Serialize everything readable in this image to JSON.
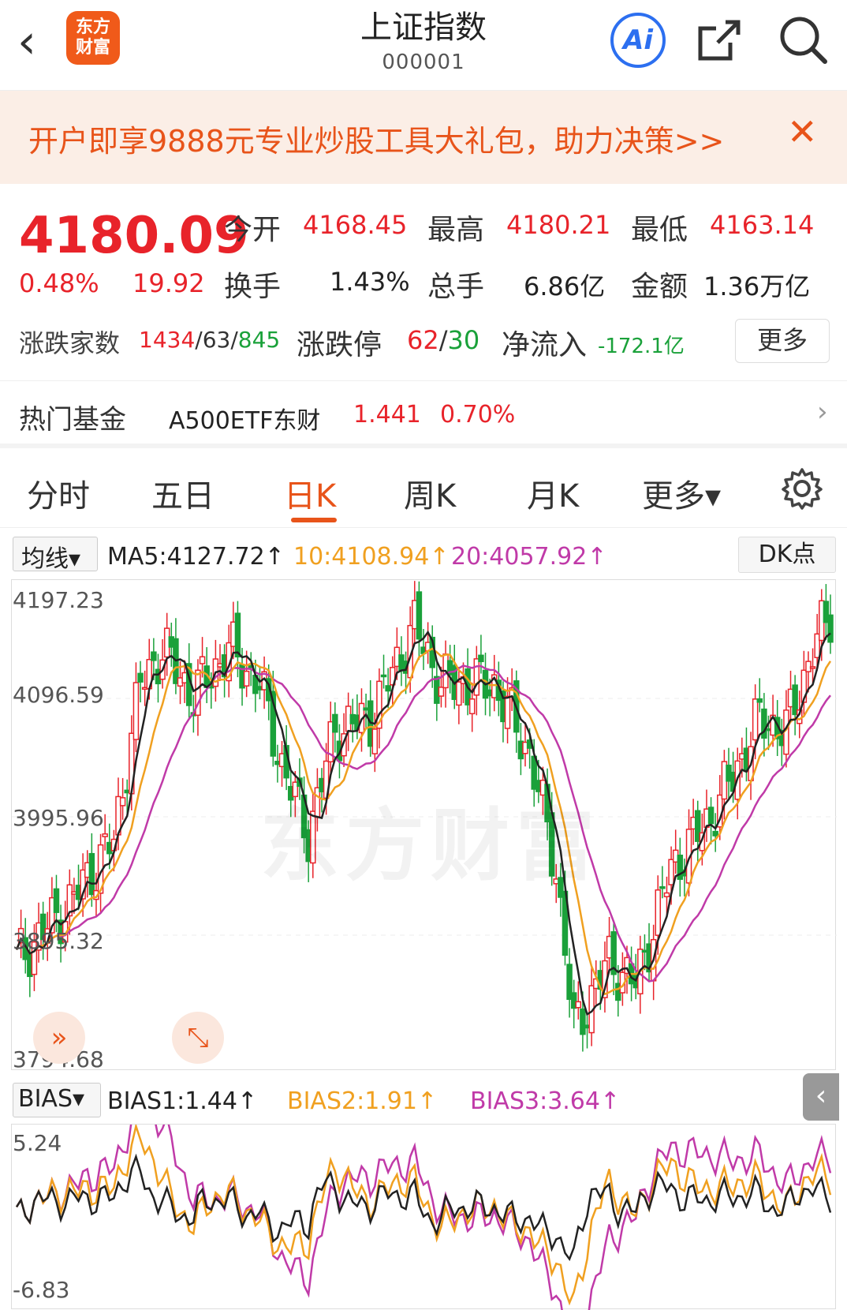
{
  "header": {
    "back_icon": "chevron-left-icon",
    "logo_text_1": "东方",
    "logo_text_2": "财富",
    "title": "上证指数",
    "code": "000001",
    "ai_label": "Ai"
  },
  "banner": {
    "text": "开户即享9888元专业炒股工具大礼包，助力决策>>",
    "close": "✕"
  },
  "quote": {
    "price": "4180.09",
    "change_pct": "0.48%",
    "change": "19.92",
    "open_label": "今开",
    "open": "4168.45",
    "high_label": "最高",
    "high": "4180.21",
    "low_label": "最低",
    "low": "4163.14",
    "turnover_label": "换手",
    "turnover": "1.43%",
    "volume_label": "总手",
    "volume": "6.86亿",
    "amount_label": "金额",
    "amount": "1.36万亿",
    "breadth_label": "涨跌家数",
    "up": "1434",
    "sep1": "/",
    "flat": "63",
    "sep2": "/",
    "down": "845",
    "limit_label": "涨跌停",
    "limit_up": "62",
    "sep3": "/",
    "limit_down": "30",
    "flow_label": "净流入",
    "flow": "-172.1亿",
    "more": "更多"
  },
  "fund": {
    "label": "热门基金",
    "name": "A500ETF东财",
    "price": "1.441",
    "pct": "0.70%",
    "arrow": "›"
  },
  "tabs": [
    "分时",
    "五日",
    "日K",
    "周K",
    "月K",
    "更多▾"
  ],
  "indicator": {
    "selector": "均线▾",
    "ma5": "MA5:4127.72",
    "ma10": "10:4108.94",
    "ma20": "20:4057.92",
    "arrow": "↑",
    "dk": "DK点"
  },
  "main_chart": {
    "y_labels": [
      "4197.23",
      "4096.59",
      "3995.96",
      "3895.32",
      "3794.68"
    ],
    "watermark": "东方财富",
    "btn_scroll": "»",
    "btn_expand": "⤡"
  },
  "bias": {
    "selector": "BIAS▾",
    "b1": "BIAS1:1.44",
    "b2": "BIAS2:1.91",
    "b3": "BIAS3:3.64",
    "arrow": "↑",
    "y_top": "5.24",
    "y_bottom": "-6.83",
    "collapse": "‹"
  },
  "colors": {
    "up": "#e8232a",
    "down": "#1aa13a",
    "ma5": "#222222",
    "ma10": "#f0a020",
    "ma20": "#c03aa8",
    "accent": "#e8541a"
  }
}
